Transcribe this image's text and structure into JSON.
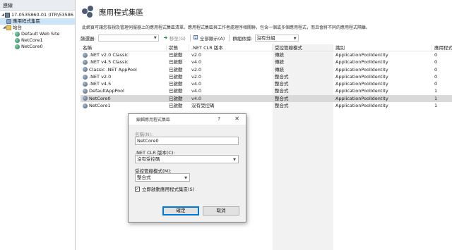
{
  "left_pane": {
    "header": "連線",
    "tree": [
      {
        "label": "17-0535860-01 (ITR\\53586",
        "icon": "server-icon",
        "level": 0,
        "expanded": true
      },
      {
        "label": "應用程式集區",
        "icon": "app-pool-icon",
        "level": 1,
        "selected": true
      },
      {
        "label": "站台",
        "icon": "folder-icon",
        "level": 1,
        "expanded": true
      },
      {
        "label": "Default Web Site",
        "icon": "globe-icon",
        "level": 2,
        "expandable": true
      },
      {
        "label": "NetCore1",
        "icon": "globe-icon",
        "level": 2
      },
      {
        "label": "NetCore0",
        "icon": "globe-icon",
        "level": 2
      }
    ]
  },
  "main": {
    "title": "應用程式集區",
    "description": "此網頁可讓您檢視及管理伺服器上的應用程式集區清單。應用程式集區與工作者處理序相關聯，包含一個或多個應用程式，而且會將不同的應用程式隔離。",
    "toolbar": {
      "filter_label": "篩選器:",
      "go_label": "移至(G)",
      "show_all_label": "全部顯示(A)",
      "group_by_label": "群組依據:",
      "group_by_value": "沒有分組"
    },
    "table": {
      "columns": [
        "名稱",
        "狀態",
        ".NET CLR 版本",
        "受控管線模式",
        "識別",
        "應用程式"
      ],
      "rows": [
        {
          "name": ".NET v2.0 Classic",
          "status": "已啟動",
          "clr": "v2.0",
          "pipeline": "傳統",
          "identity": "ApplicationPoolIdentity",
          "apps": "0"
        },
        {
          "name": ".NET v4.5 Classic",
          "status": "已啟動",
          "clr": "v4.0",
          "pipeline": "傳統",
          "identity": "ApplicationPoolIdentity",
          "apps": "0"
        },
        {
          "name": "Classic .NET AppPool",
          "status": "已啟動",
          "clr": "v2.0",
          "pipeline": "傳統",
          "identity": "ApplicationPoolIdentity",
          "apps": "0"
        },
        {
          "name": ".NET v2.0",
          "status": "已啟動",
          "clr": "v2.0",
          "pipeline": "整合式",
          "identity": "ApplicationPoolIdentity",
          "apps": "0"
        },
        {
          "name": ".NET v4.5",
          "status": "已啟動",
          "clr": "v4.0",
          "pipeline": "整合式",
          "identity": "ApplicationPoolIdentity",
          "apps": "0"
        },
        {
          "name": "DefaultAppPool",
          "status": "已啟動",
          "clr": "v4.0",
          "pipeline": "整合式",
          "identity": "ApplicationPoolIdentity",
          "apps": "1"
        },
        {
          "name": "NetCore0",
          "status": "已啟動",
          "clr": "v4.0",
          "pipeline": "整合式",
          "identity": "ApplicationPoolIdentity",
          "apps": "1",
          "selected": true
        },
        {
          "name": "NetCore1",
          "status": "已啟動",
          "clr": "沒有受控碼",
          "pipeline": "整合式",
          "identity": "ApplicationPoolIdentity",
          "apps": "1"
        }
      ]
    }
  },
  "dialog": {
    "title": "編輯應用程式集區",
    "help": "?",
    "close": "✕",
    "name_label": "名稱(N):",
    "name_value": "NetCore0",
    "clr_label": ".NET CLR 版本(C):",
    "clr_value": "沒有受控碼",
    "pipeline_label": "受控管線模式(M):",
    "pipeline_value": "整合式",
    "autostart_label": "立即啟動應用程式集區(S)",
    "autostart_checked": true,
    "ok_label": "確定",
    "cancel_label": "取消"
  },
  "colors": {
    "selection": "#cce4f7",
    "row_selected": "#d9d9d9",
    "accent": "#0078d7"
  }
}
